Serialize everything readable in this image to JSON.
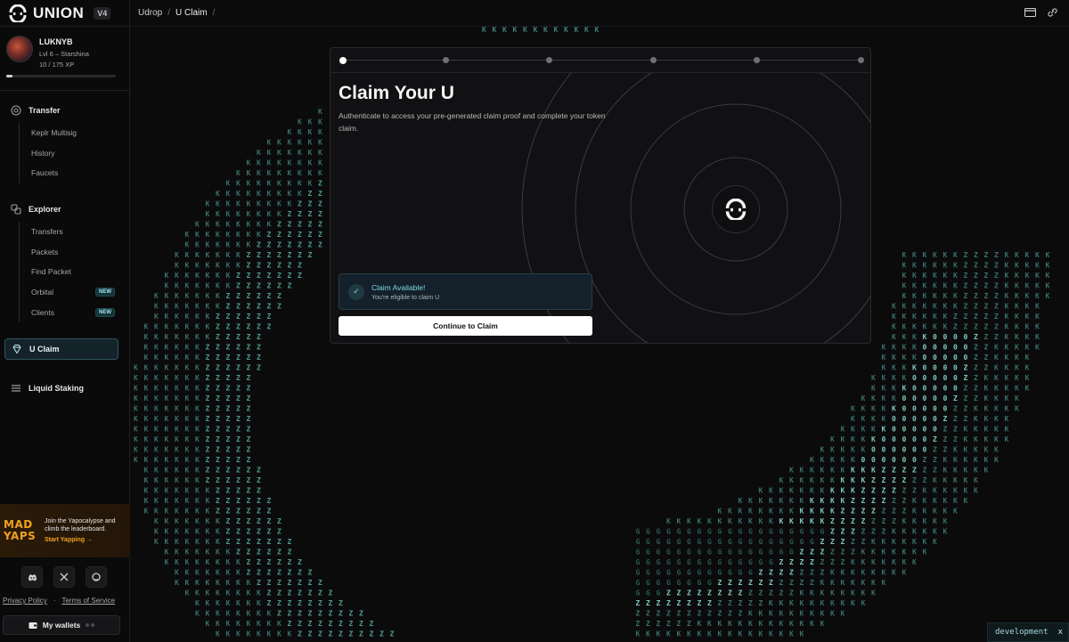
{
  "brand": {
    "name": "UNION",
    "version": "V4"
  },
  "profile": {
    "name": "LUKNYB",
    "level": "Lvl 6 – Starshina",
    "xp": "10 / 175 XP",
    "xp_fraction": 0.06
  },
  "nav": {
    "transfer": {
      "label": "Transfer",
      "items": [
        "Keplr Multisig",
        "History",
        "Faucets"
      ]
    },
    "explorer": {
      "label": "Explorer",
      "items": [
        {
          "label": "Transfers",
          "badge": ""
        },
        {
          "label": "Packets",
          "badge": ""
        },
        {
          "label": "Find Packet",
          "badge": ""
        },
        {
          "label": "Orbital",
          "badge": "NEW"
        },
        {
          "label": "Clients",
          "badge": "NEW"
        }
      ]
    },
    "active": {
      "label": "U Claim"
    },
    "staking": {
      "label": "Liquid Staking"
    }
  },
  "promo": {
    "logo_line1": "MAD",
    "logo_line2": "YAPS",
    "text": "Join the Yapocalypse and climb the leaderboard.",
    "cta": "Start Yapping →"
  },
  "footer": {
    "privacy": "Privacy Policy",
    "separator": "·",
    "terms": "Terms of Service",
    "wallets": "My wallets"
  },
  "breadcrumb": {
    "root": "Udrop",
    "current": "U Claim",
    "sep": "/"
  },
  "card": {
    "title": "Claim Your U",
    "description": "Authenticate to access your pre-generated claim proof and complete your token claim.",
    "steps": 6,
    "active_step": 1,
    "status_title": "Claim Available!",
    "status_sub": "You're eligible to claim U",
    "button": "Continue to Claim"
  },
  "devtag": {
    "label": "development",
    "close": "x"
  },
  "colors": {
    "accent": "#7fdbe6",
    "matrix": "#4f8f8b",
    "promo": "#f0a21e"
  }
}
